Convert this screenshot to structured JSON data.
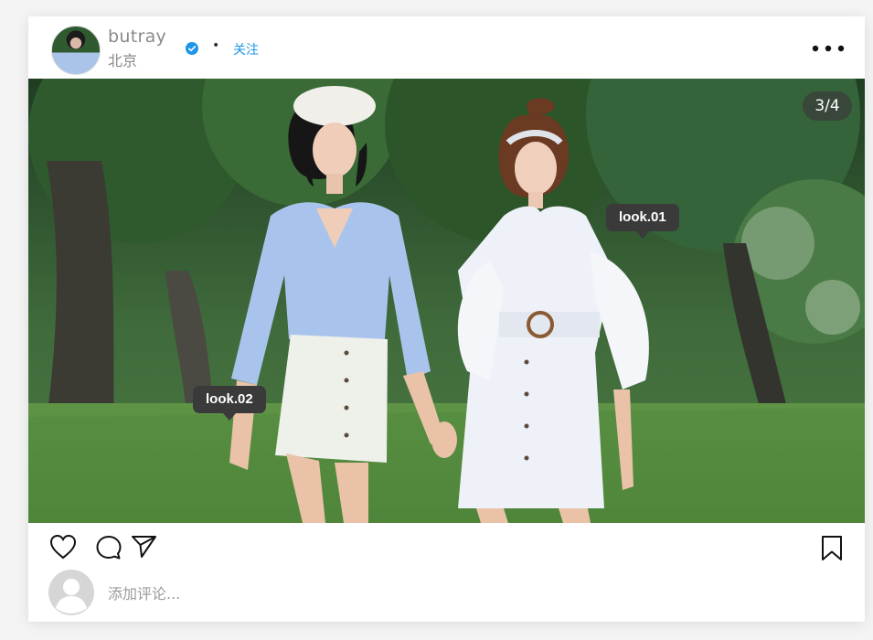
{
  "post": {
    "username": "butray",
    "location": "北京",
    "follow_label": "关注",
    "separator": "•",
    "image_counter": "3/4",
    "tags": [
      {
        "label": "look.01"
      },
      {
        "label": "look.02"
      }
    ]
  },
  "comment": {
    "placeholder": "添加评论..."
  },
  "colors": {
    "accent": "#1e96e8",
    "tag_bg": "#3a3a3a"
  },
  "icons": [
    "verified-badge-icon",
    "more-options-icon",
    "heart-icon",
    "comment-icon",
    "send-icon",
    "bookmark-icon"
  ]
}
